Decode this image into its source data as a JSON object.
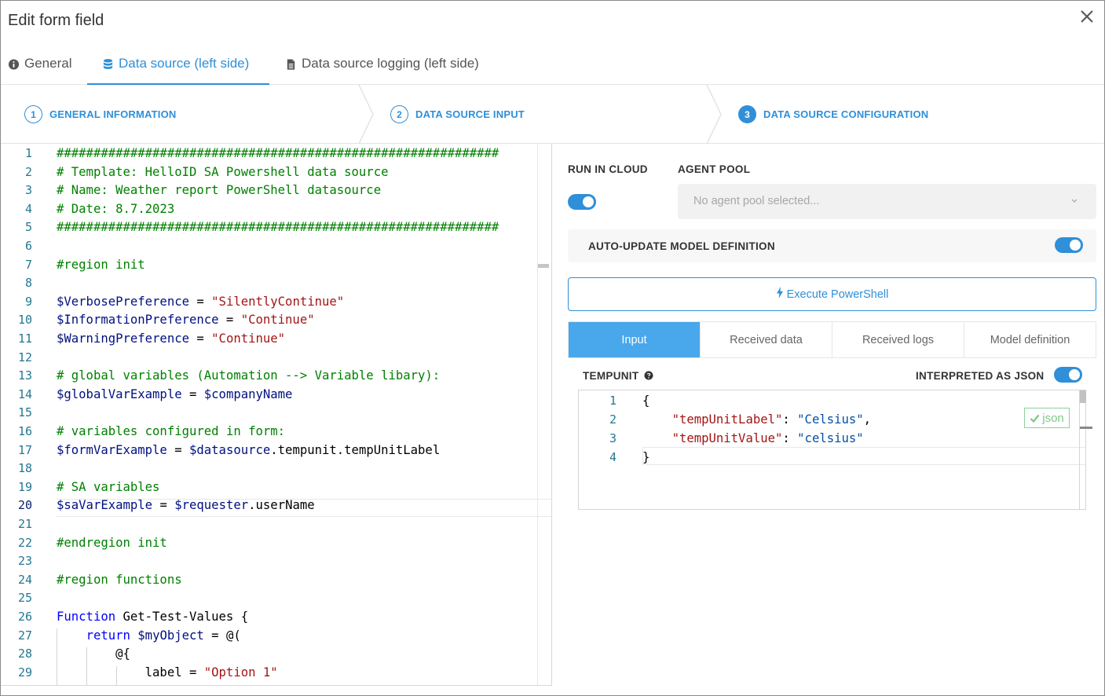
{
  "dialog": {
    "title": "Edit form field"
  },
  "tabs": [
    {
      "label": "General",
      "icon": "info-circle-icon"
    },
    {
      "label": "Data source (left side)",
      "icon": "database-icon",
      "active": true
    },
    {
      "label": "Data source logging (left side)",
      "icon": "file-text-icon"
    }
  ],
  "stepper": [
    {
      "number": "1",
      "label": "GENERAL INFORMATION"
    },
    {
      "number": "2",
      "label": "DATA SOURCE INPUT"
    },
    {
      "number": "3",
      "label": "DATA SOURCE CONFIGURATION",
      "active": true
    }
  ],
  "editor": {
    "current_line": "20",
    "lines": [
      {
        "n": "1",
        "parts": [
          {
            "c": "com",
            "t": "############################################################"
          }
        ]
      },
      {
        "n": "2",
        "parts": [
          {
            "c": "com",
            "t": "# Template: HelloID SA Powershell data source"
          }
        ]
      },
      {
        "n": "3",
        "parts": [
          {
            "c": "com",
            "t": "# Name: Weather report PowerShell datasource"
          }
        ]
      },
      {
        "n": "4",
        "parts": [
          {
            "c": "com",
            "t": "# Date: 8.7.2023"
          }
        ]
      },
      {
        "n": "5",
        "parts": [
          {
            "c": "com",
            "t": "############################################################"
          }
        ]
      },
      {
        "n": "6",
        "parts": []
      },
      {
        "n": "7",
        "parts": [
          {
            "c": "com",
            "t": "#region init"
          }
        ]
      },
      {
        "n": "8",
        "parts": []
      },
      {
        "n": "9",
        "parts": [
          {
            "c": "var",
            "t": "$VerbosePreference"
          },
          {
            "c": "txt",
            "t": " = "
          },
          {
            "c": "str",
            "t": "\"SilentlyContinue\""
          }
        ]
      },
      {
        "n": "10",
        "parts": [
          {
            "c": "var",
            "t": "$InformationPreference"
          },
          {
            "c": "txt",
            "t": " = "
          },
          {
            "c": "str",
            "t": "\"Continue\""
          }
        ]
      },
      {
        "n": "11",
        "parts": [
          {
            "c": "var",
            "t": "$WarningPreference"
          },
          {
            "c": "txt",
            "t": " = "
          },
          {
            "c": "str",
            "t": "\"Continue\""
          }
        ]
      },
      {
        "n": "12",
        "parts": []
      },
      {
        "n": "13",
        "parts": [
          {
            "c": "com",
            "t": "# global variables (Automation --> Variable libary):"
          }
        ]
      },
      {
        "n": "14",
        "parts": [
          {
            "c": "var",
            "t": "$globalVarExample"
          },
          {
            "c": "txt",
            "t": " = "
          },
          {
            "c": "var",
            "t": "$companyName"
          }
        ]
      },
      {
        "n": "15",
        "parts": []
      },
      {
        "n": "16",
        "parts": [
          {
            "c": "com",
            "t": "# variables configured in form:"
          }
        ]
      },
      {
        "n": "17",
        "parts": [
          {
            "c": "var",
            "t": "$formVarExample"
          },
          {
            "c": "txt",
            "t": " = "
          },
          {
            "c": "var",
            "t": "$datasource"
          },
          {
            "c": "txt",
            "t": ".tempunit.tempUnitLabel"
          }
        ]
      },
      {
        "n": "18",
        "parts": []
      },
      {
        "n": "19",
        "parts": [
          {
            "c": "com",
            "t": "# SA variables"
          }
        ]
      },
      {
        "n": "20",
        "parts": [
          {
            "c": "var",
            "t": "$saVarExample"
          },
          {
            "c": "txt",
            "t": " = "
          },
          {
            "c": "var",
            "t": "$requester"
          },
          {
            "c": "txt",
            "t": ".userName"
          }
        ]
      },
      {
        "n": "21",
        "parts": []
      },
      {
        "n": "22",
        "parts": [
          {
            "c": "com",
            "t": "#endregion init"
          }
        ]
      },
      {
        "n": "23",
        "parts": []
      },
      {
        "n": "24",
        "parts": [
          {
            "c": "com",
            "t": "#region functions"
          }
        ]
      },
      {
        "n": "25",
        "parts": []
      },
      {
        "n": "26",
        "parts": [
          {
            "c": "kw",
            "t": "Function"
          },
          {
            "c": "txt",
            "t": " Get-Test-Values {"
          }
        ]
      },
      {
        "n": "27",
        "parts": [
          {
            "c": "txt",
            "t": "    "
          },
          {
            "c": "kw",
            "t": "return"
          },
          {
            "c": "txt",
            "t": " "
          },
          {
            "c": "var",
            "t": "$myObject"
          },
          {
            "c": "txt",
            "t": " = @("
          }
        ]
      },
      {
        "n": "28",
        "parts": [
          {
            "c": "txt",
            "t": "        @{"
          }
        ]
      },
      {
        "n": "29",
        "parts": [
          {
            "c": "txt",
            "t": "            label = "
          },
          {
            "c": "str",
            "t": "\"Option 1\""
          }
        ]
      }
    ]
  },
  "config": {
    "run_in_cloud_label": "RUN IN CLOUD",
    "run_in_cloud_on": true,
    "agent_pool_label": "AGENT POOL",
    "agent_pool_placeholder": "No agent pool selected...",
    "auto_update_label": "AUTO-UPDATE MODEL DEFINITION",
    "auto_update_on": true,
    "execute_label": "Execute PowerShell",
    "subtabs": [
      {
        "label": "Input",
        "active": true
      },
      {
        "label": "Received data"
      },
      {
        "label": "Received logs"
      },
      {
        "label": "Model definition"
      }
    ],
    "input_field_label": "TEMPUNIT",
    "interpreted_label": "INTERPRETED AS JSON",
    "interpreted_on": true,
    "json_badge": "json",
    "json_lines": [
      {
        "n": "1",
        "parts": [
          {
            "c": "txt",
            "t": "{"
          }
        ]
      },
      {
        "n": "2",
        "parts": [
          {
            "c": "txt",
            "t": "    "
          },
          {
            "c": "key",
            "t": "\"tempUnitLabel\""
          },
          {
            "c": "txt",
            "t": ": "
          },
          {
            "c": "val",
            "t": "\"Celsius\""
          },
          {
            "c": "txt",
            "t": ","
          }
        ]
      },
      {
        "n": "3",
        "parts": [
          {
            "c": "txt",
            "t": "    "
          },
          {
            "c": "key",
            "t": "\"tempUnitValue\""
          },
          {
            "c": "txt",
            "t": ": "
          },
          {
            "c": "val",
            "t": "\"celsius\""
          }
        ]
      },
      {
        "n": "4",
        "parts": [
          {
            "c": "txt",
            "t": "}"
          }
        ]
      }
    ]
  },
  "colors": {
    "accent": "#2f8fd8",
    "active_subtab": "#49a7eb",
    "comment": "#008000",
    "variable": "#001080",
    "string": "#a31515",
    "keyword": "#0000ff"
  }
}
